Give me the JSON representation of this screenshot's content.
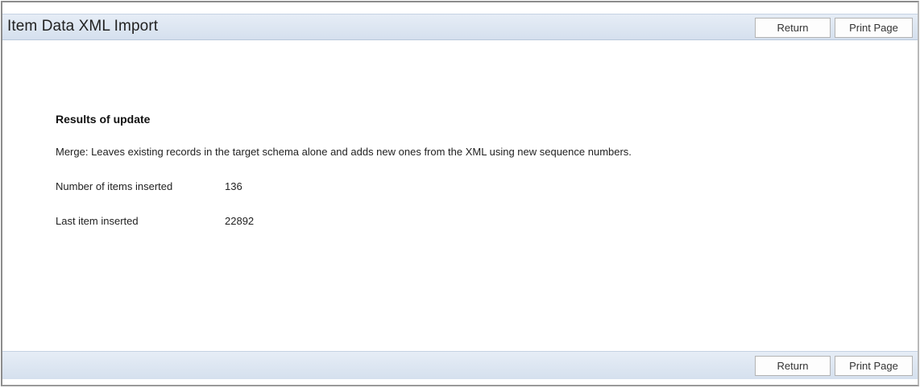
{
  "header": {
    "title": "Item Data XML Import",
    "return_label": "Return",
    "print_label": "Print Page"
  },
  "results": {
    "heading": "Results of update",
    "description": "Merge: Leaves existing records in the target schema alone and adds new ones from the XML using new sequence numbers.",
    "rows": [
      {
        "label": "Number of items inserted",
        "value": "136"
      },
      {
        "label": "Last item inserted",
        "value": "22892"
      }
    ]
  },
  "footer": {
    "return_label": "Return",
    "print_label": "Print Page"
  }
}
